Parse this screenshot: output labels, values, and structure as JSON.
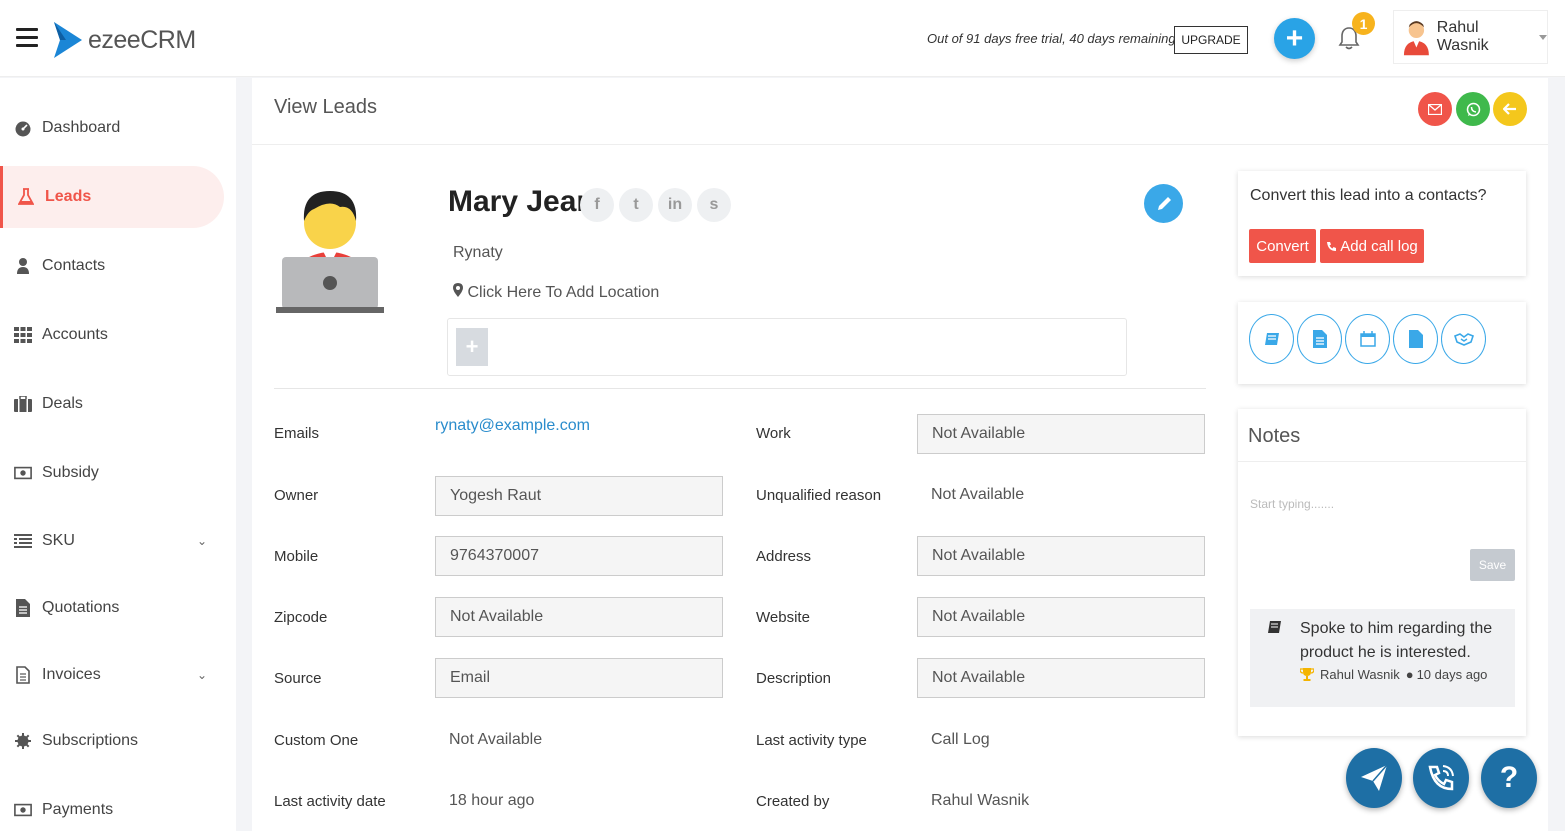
{
  "app": {
    "name": "ezeeCRM"
  },
  "topbar": {
    "trial_text": "Out of 91 days free trial, 40 days remaining",
    "upgrade_label": "UPGRADE",
    "notification_count": "1",
    "user_name": "Rahul Wasnik"
  },
  "sidebar": {
    "items": [
      {
        "label": "Dashboard",
        "icon": "dashboard-icon"
      },
      {
        "label": "Leads",
        "icon": "flask-icon",
        "active": true
      },
      {
        "label": "Contacts",
        "icon": "user-icon"
      },
      {
        "label": "Accounts",
        "icon": "grid-icon"
      },
      {
        "label": "Deals",
        "icon": "briefcase-icon"
      },
      {
        "label": "Subsidy",
        "icon": "money-icon"
      },
      {
        "label": "SKU",
        "icon": "list-icon",
        "has_submenu": true
      },
      {
        "label": "Quotations",
        "icon": "file-icon"
      },
      {
        "label": "Invoices",
        "icon": "document-icon",
        "has_submenu": true
      },
      {
        "label": "Subscriptions",
        "icon": "cog-icon"
      },
      {
        "label": "Payments",
        "icon": "money-icon"
      }
    ]
  },
  "page": {
    "title": "View Leads",
    "colors": {
      "email": "#f0554a",
      "whatsapp": "#3fb94c",
      "back": "#f4c71c",
      "accent": "#3aa8e8"
    }
  },
  "lead": {
    "name": "Mary Jean",
    "company": "Rynaty",
    "location_prompt": "Click Here To Add Location",
    "social": [
      "f",
      "t",
      "in",
      "s"
    ]
  },
  "fields": {
    "emails": {
      "label": "Emails",
      "value": "rynaty@example.com"
    },
    "owner": {
      "label": "Owner",
      "value": "Yogesh Raut"
    },
    "mobile": {
      "label": "Mobile",
      "value": "9764370007"
    },
    "zipcode": {
      "label": "Zipcode",
      "value": "Not Available"
    },
    "source": {
      "label": "Source",
      "value": "Email"
    },
    "custom_one": {
      "label": "Custom One",
      "value": "Not Available"
    },
    "last_activity_date": {
      "label": "Last activity date",
      "value": "18 hour ago"
    },
    "work": {
      "label": "Work",
      "value": "Not Available"
    },
    "unqualified_reason": {
      "label": "Unqualified reason",
      "value": "Not Available"
    },
    "address": {
      "label": "Address",
      "value": "Not Available"
    },
    "website": {
      "label": "Website",
      "value": "Not Available"
    },
    "description": {
      "label": "Description",
      "value": "Not Available"
    },
    "last_activity_type": {
      "label": "Last activity type",
      "value": "Call Log"
    },
    "created_by": {
      "label": "Created by",
      "value": "Rahul Wasnik"
    }
  },
  "convert_card": {
    "question": "Convert this lead into a contacts?",
    "convert_label": "Convert",
    "call_log_label": "Add call log"
  },
  "notes": {
    "title": "Notes",
    "placeholder": "Start typing.......",
    "save_label": "Save",
    "items": [
      {
        "text": "Spoke to him regarding the product he is interested.",
        "author": "Rahul Wasnik",
        "time": "10 days ago"
      }
    ]
  }
}
